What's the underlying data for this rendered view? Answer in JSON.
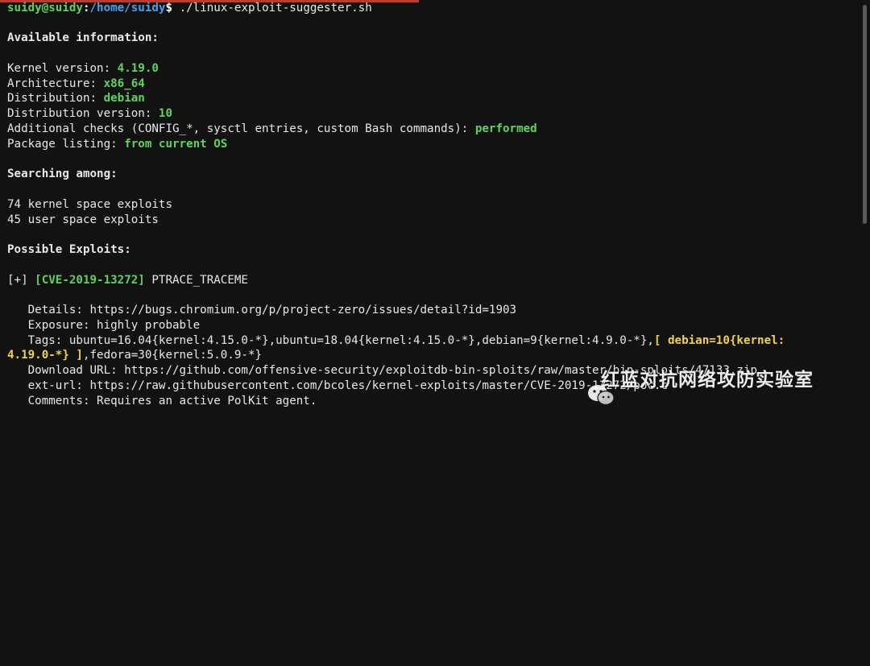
{
  "prompt": {
    "user_host": "suidy@suidy",
    "sep": ":",
    "path": "/home/suidy",
    "symbol": "$ ",
    "command": "./linux-exploit-suggester.sh"
  },
  "info": {
    "heading": "Available information:",
    "kernel_label": "Kernel version: ",
    "kernel_value": "4.19.0",
    "arch_label": "Architecture: ",
    "arch_value": "x86_64",
    "dist_label": "Distribution: ",
    "dist_value": "debian",
    "distver_label": "Distribution version: ",
    "distver_value": "10",
    "checks_label": "Additional checks (CONFIG_*, sysctl entries, custom Bash commands): ",
    "checks_value": "performed",
    "pkg_label": "Package listing: ",
    "pkg_value": "from current OS"
  },
  "search": {
    "heading": "Searching among:",
    "kernel_count": "74 kernel space exploits",
    "user_count": "45 user space exploits"
  },
  "exploits": {
    "heading": "Possible Exploits:",
    "prefix": "[+] ",
    "cve": "[CVE-2019-13272]",
    "name": " PTRACE_TRACEME",
    "details": "   Details: https://bugs.chromium.org/p/project-zero/issues/detail?id=1903",
    "exposure": "   Exposure: highly probable",
    "tags_prefix": "   Tags: ubuntu=16.04{kernel:4.15.0-*},ubuntu=18.04{kernel:4.15.0-*},debian=9{kernel:4.9.0-*},",
    "tags_highlight_1": "[ debian=10{kernel:",
    "tags_highlight_2": "4.19.0-*} ]",
    "tags_suffix": ",fedora=30{kernel:5.0.9-*}",
    "download": "   Download URL: https://github.com/offensive-security/exploitdb-bin-sploits/raw/master/bin-sploits/47133.zip",
    "ext_url": "   ext-url: https://raw.githubusercontent.com/bcoles/kernel-exploits/master/CVE-2019-13272/poc.c",
    "comments": "   Comments: Requires an active PolKit agent."
  },
  "watermark": {
    "icon": "wechat-icon",
    "text": "红蓝对抗网络攻防实验室"
  },
  "colors": {
    "background": "#121212",
    "green": "#5fd35f",
    "yellow": "#f0d24a",
    "path_blue": "#4aa0f0",
    "accent_bar": "#c0392b"
  }
}
